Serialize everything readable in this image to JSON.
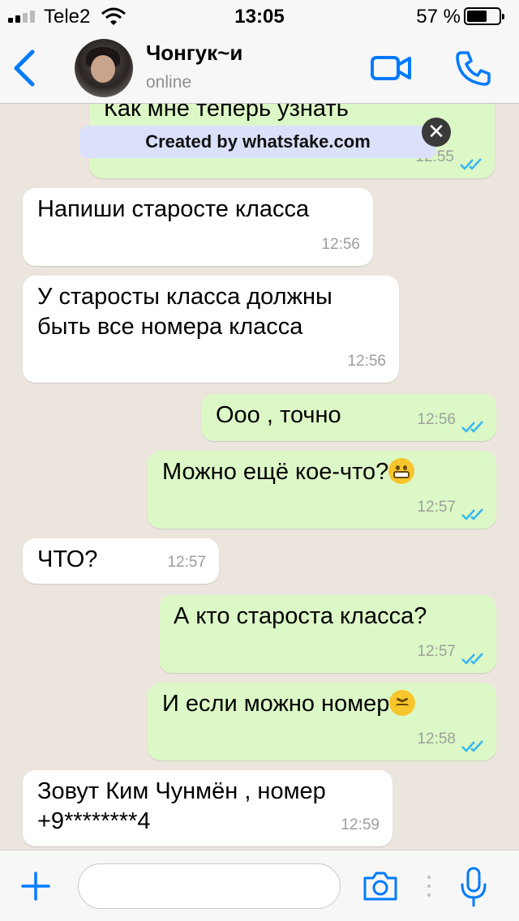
{
  "status_bar": {
    "carrier": "Tele2",
    "time": "13:05",
    "battery_percent": "57 %",
    "battery_level": 0.57,
    "icons": [
      "signal-icon",
      "wifi-icon",
      "battery-icon"
    ]
  },
  "header": {
    "contact_name": "Чонгук~и",
    "contact_status": "online",
    "icons": [
      "back-arrow-icon",
      "avatar",
      "video-call-icon",
      "phone-icon"
    ],
    "accent_color": "#007aff"
  },
  "watermark": {
    "text": "Created by whatsfake.com",
    "close_glyph": "✕"
  },
  "messages": [
    {
      "direction": "out",
      "text": "Как мне теперь узнать\nномер новенькой?",
      "time": "12:55",
      "read": true
    },
    {
      "direction": "in",
      "text": "Напиши старосте класса",
      "time": "12:56"
    },
    {
      "direction": "in",
      "text": "У старосты класса должны\nбыть все номера класса",
      "time": "12:56"
    },
    {
      "direction": "out",
      "text": "Ооо , точно",
      "time": "12:56",
      "read": true
    },
    {
      "direction": "out",
      "text": "Можно ещё кое-что?",
      "emoji": "grimacing",
      "time": "12:57",
      "read": true
    },
    {
      "direction": "in",
      "text": "ЧТО?",
      "time": "12:57"
    },
    {
      "direction": "out",
      "text": "А кто староста класса?",
      "time": "12:57",
      "read": true
    },
    {
      "direction": "out",
      "text": "И если можно номер",
      "emoji": "confounded",
      "time": "12:58",
      "read": true
    },
    {
      "direction": "in",
      "text": "Зовут Ким Чунмён , номер\n+9********4",
      "time": "12:59"
    }
  ],
  "input_bar": {
    "placeholder": "",
    "icons": [
      "plus-icon",
      "camera-icon",
      "microphone-icon"
    ]
  },
  "colors": {
    "chat_background": "#ece5dd",
    "outgoing_bubble": "#dcf8c6",
    "incoming_bubble": "#ffffff",
    "read_ticks": "#34b7f1"
  }
}
